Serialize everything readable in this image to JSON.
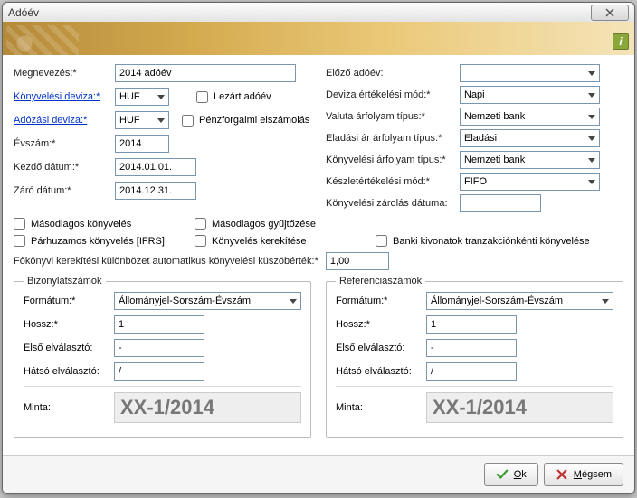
{
  "window": {
    "title": "Adóév"
  },
  "banner": {
    "info_icon_name": "info-icon"
  },
  "left": {
    "megnevezes_label": "Megnevezés:*",
    "megnevezes_value": "2014 adóév",
    "konyvelesi_deviza_label": "Könyvelési deviza:*",
    "konyvelesi_deviza_value": "HUF",
    "adozasi_deviza_label": "Adózási deviza:*",
    "adozasi_deviza_value": "HUF",
    "evszam_label": "Évszám:*",
    "evszam_value": "2014",
    "kezdo_datum_label": "Kezdő dátum:*",
    "kezdo_datum_value": "2014.01.01.",
    "zaro_datum_label": "Záró dátum:*",
    "zaro_datum_value": "2014.12.31.",
    "lezart_adoev_label": "Lezárt adóév",
    "penzforg_label": "Pénzforgalmi elszámolás"
  },
  "right": {
    "elozo_adoev_label": "Előző adóév:",
    "elozo_adoev_value": "",
    "deviza_ert_mod_label": "Deviza értékelési mód:*",
    "deviza_ert_mod_value": "Napi",
    "valuta_arfolyam_label": "Valuta árfolyam típus:*",
    "valuta_arfolyam_value": "Nemzeti bank",
    "eladasi_ar_label": "Eladási ár árfolyam típus:*",
    "eladasi_ar_value": "Eladási",
    "konyvelesi_arf_label": "Könyvelési árfolyam típus:*",
    "konyvelesi_arf_value": "Nemzeti bank",
    "keszlet_mod_label": "Készletértékelési mód:*",
    "keszlet_mod_value": "FIFO",
    "konyv_zar_label": "Könyvelési zárolás dátuma:",
    "konyv_zar_value": ""
  },
  "mid_checks": {
    "masod_konyv": "Másodlagos könyvelés",
    "masod_gyujt": "Másodlagos gyűjtőzése",
    "parhuzamos": "Párhuzamos könyvelés [IFRS]",
    "konyv_kerekit": "Könyvelés kerekítése",
    "banki_kivonat": "Banki kivonatok tranzakciónkénti könyvelése",
    "fok_kerekit_label": "Főkönyvi kerekítési különbözet automatikus könyvelési küszöbérték:*",
    "fok_kerekit_value": "1,00"
  },
  "bizonylat": {
    "legend": "Bizonylatszámok",
    "formatum_label": "Formátum:*",
    "formatum_value": "Állományjel-Sorszám-Évszám",
    "hossz_label": "Hossz:*",
    "hossz_value": "1",
    "elso_elv_label": "Első elválasztó:",
    "elso_elv_value": "-",
    "hatso_elv_label": "Hátsó elválasztó:",
    "hatso_elv_value": "/",
    "minta_label": "Minta:",
    "minta_value": "XX-1/2014"
  },
  "referencia": {
    "legend": "Referenciaszámok",
    "formatum_label": "Formátum:*",
    "formatum_value": "Állományjel-Sorszám-Évszám",
    "hossz_label": "Hossz:*",
    "hossz_value": "1",
    "elso_elv_label": "Első elválasztó:",
    "elso_elv_value": "-",
    "hatso_elv_label": "Hátsó elválasztó:",
    "hatso_elv_value": "/",
    "minta_label": "Minta:",
    "minta_value": "XX-1/2014"
  },
  "buttons": {
    "ok_char": "O",
    "ok_rest": "k",
    "cancel_char": "M",
    "cancel_rest": "égsem"
  }
}
